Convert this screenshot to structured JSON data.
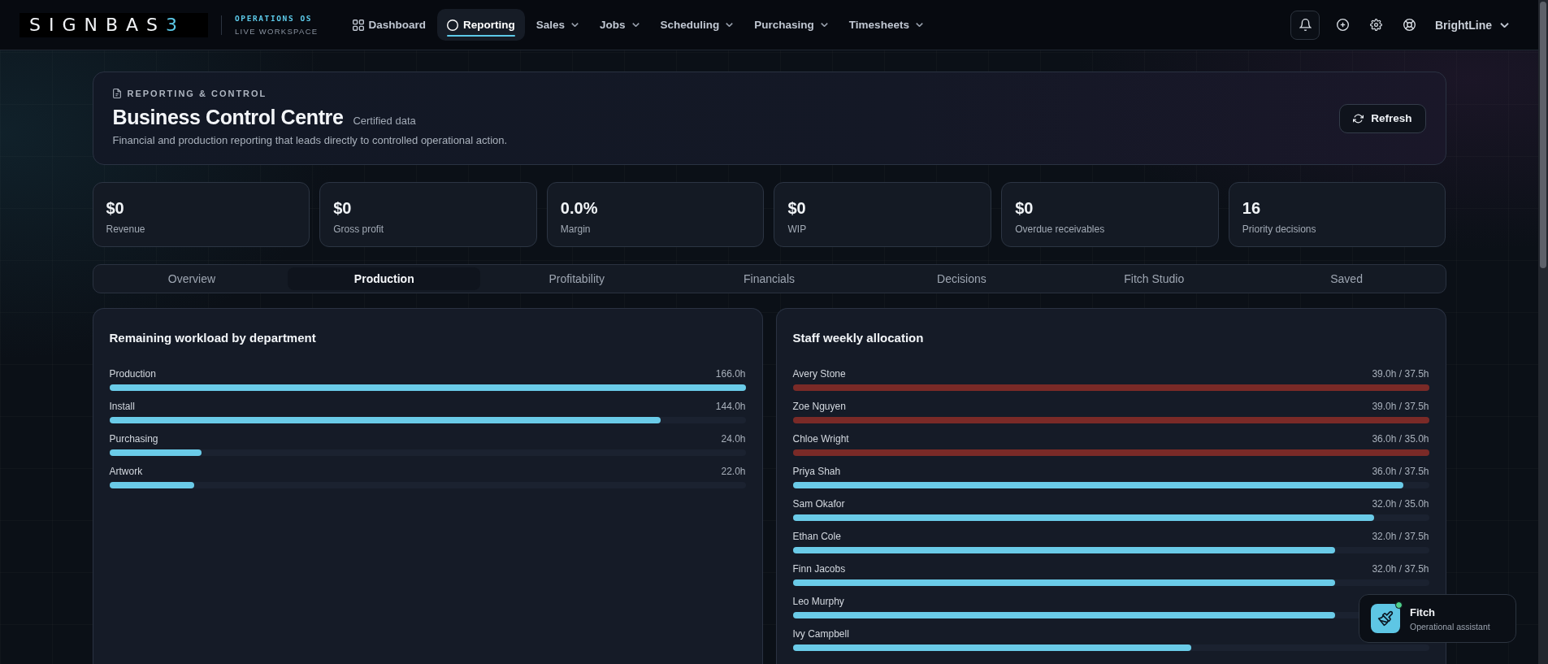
{
  "top_bar": {
    "logo": {
      "text": "SIGNBAS",
      "accent": "3"
    },
    "workspace": {
      "title": "OPERATIONS OS",
      "subtitle": "LIVE WORKSPACE"
    },
    "nav_items": [
      {
        "label": "Dashboard",
        "kind": "page",
        "selected": false
      },
      {
        "label": "Reporting",
        "kind": "page",
        "selected": true
      },
      {
        "label": "Sales",
        "kind": "menu",
        "selected": false
      },
      {
        "label": "Jobs",
        "kind": "menu",
        "selected": false
      },
      {
        "label": "Scheduling",
        "kind": "menu",
        "selected": false
      },
      {
        "label": "Purchasing",
        "kind": "menu",
        "selected": false
      },
      {
        "label": "Timesheets",
        "kind": "menu",
        "selected": false
      }
    ],
    "account": {
      "name": "BrightLine"
    }
  },
  "header": {
    "eyebrow": "REPORTING & CONTROL",
    "title": "Business Control Centre",
    "note": "Certified data",
    "description": "Financial and production reporting that leads directly to controlled operational action.",
    "refresh_button": "Refresh"
  },
  "kpis": [
    {
      "value": "$0",
      "label": "Revenue"
    },
    {
      "value": "$0",
      "label": "Gross profit"
    },
    {
      "value": "0.0%",
      "label": "Margin"
    },
    {
      "value": "$0",
      "label": "WIP"
    },
    {
      "value": "$0",
      "label": "Overdue receivables"
    },
    {
      "value": "16",
      "label": "Priority decisions"
    }
  ],
  "report_tabs": [
    {
      "label": "Overview",
      "selected": false
    },
    {
      "label": "Production",
      "selected": true
    },
    {
      "label": "Profitability",
      "selected": false
    },
    {
      "label": "Financials",
      "selected": false
    },
    {
      "label": "Decisions",
      "selected": false
    },
    {
      "label": "Fitch Studio",
      "selected": false
    },
    {
      "label": "Saved",
      "selected": false
    }
  ],
  "workload_panel": {
    "title": "Remaining workload by department",
    "rows": [
      {
        "label": "Production",
        "reading": "166.0h",
        "level": 1.0
      },
      {
        "label": "Install",
        "reading": "144.0h",
        "level": 0.867
      },
      {
        "label": "Purchasing",
        "reading": "24.0h",
        "level": 0.145
      },
      {
        "label": "Artwork",
        "reading": "22.0h",
        "level": 0.133
      }
    ]
  },
  "allocation_panel": {
    "title": "Staff weekly allocation",
    "rows": [
      {
        "name": "Avery Stone",
        "reading": "39.0h / 37.5h",
        "level": 1.0,
        "over_allocated": true
      },
      {
        "name": "Zoe Nguyen",
        "reading": "39.0h / 37.5h",
        "level": 1.0,
        "over_allocated": true
      },
      {
        "name": "Chloe Wright",
        "reading": "36.0h / 35.0h",
        "level": 1.0,
        "over_allocated": true
      },
      {
        "name": "Priya Shah",
        "reading": "36.0h / 37.5h",
        "level": 0.96,
        "over_allocated": false
      },
      {
        "name": "Sam Okafor",
        "reading": "32.0h / 35.0h",
        "level": 0.914,
        "over_allocated": false
      },
      {
        "name": "Ethan Cole",
        "reading": "32.0h / 37.5h",
        "level": 0.853,
        "over_allocated": false
      },
      {
        "name": "Finn Jacobs",
        "reading": "32.0h / 37.5h",
        "level": 0.853,
        "over_allocated": false
      },
      {
        "name": "Leo Murphy",
        "level": 0.853,
        "over_allocated": false
      },
      {
        "name": "Ivy Campbell",
        "level": 0.627,
        "over_allocated": false
      }
    ]
  },
  "assistant": {
    "name": "Fitch",
    "subtitle": "Operational assistant",
    "online": true
  }
}
